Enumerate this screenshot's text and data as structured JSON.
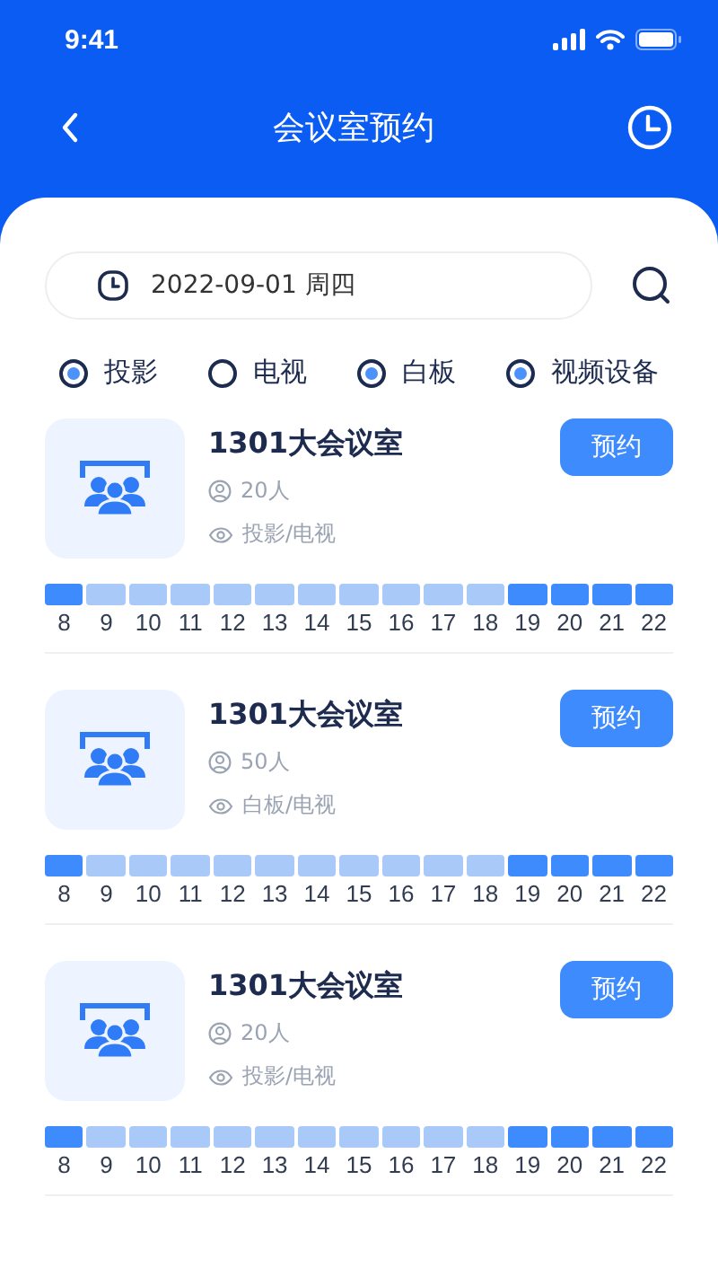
{
  "status_bar": {
    "time": "9:41"
  },
  "nav": {
    "title": "会议室预约"
  },
  "search": {
    "date": "2022-09-01 周四"
  },
  "filters": [
    {
      "label": "投影",
      "selected": true
    },
    {
      "label": "电视",
      "selected": false
    },
    {
      "label": "白板",
      "selected": true
    },
    {
      "label": "视频设备",
      "selected": true
    }
  ],
  "rooms": [
    {
      "name": "1301大会议室",
      "capacity": "20人",
      "equipment": "投影/电视",
      "button": "预约",
      "slots": [
        {
          "hour": "8",
          "booked": true
        },
        {
          "hour": "9",
          "booked": false
        },
        {
          "hour": "10",
          "booked": false
        },
        {
          "hour": "11",
          "booked": false
        },
        {
          "hour": "12",
          "booked": false
        },
        {
          "hour": "13",
          "booked": false
        },
        {
          "hour": "14",
          "booked": false
        },
        {
          "hour": "15",
          "booked": false
        },
        {
          "hour": "16",
          "booked": false
        },
        {
          "hour": "17",
          "booked": false
        },
        {
          "hour": "18",
          "booked": false
        },
        {
          "hour": "19",
          "booked": true
        },
        {
          "hour": "20",
          "booked": true
        },
        {
          "hour": "21",
          "booked": true
        },
        {
          "hour": "22",
          "booked": true
        }
      ]
    },
    {
      "name": "1301大会议室",
      "capacity": "50人",
      "equipment": "白板/电视",
      "button": "预约",
      "slots": [
        {
          "hour": "8",
          "booked": true
        },
        {
          "hour": "9",
          "booked": false
        },
        {
          "hour": "10",
          "booked": false
        },
        {
          "hour": "11",
          "booked": false
        },
        {
          "hour": "12",
          "booked": false
        },
        {
          "hour": "13",
          "booked": false
        },
        {
          "hour": "14",
          "booked": false
        },
        {
          "hour": "15",
          "booked": false
        },
        {
          "hour": "16",
          "booked": false
        },
        {
          "hour": "17",
          "booked": false
        },
        {
          "hour": "18",
          "booked": false
        },
        {
          "hour": "19",
          "booked": true
        },
        {
          "hour": "20",
          "booked": true
        },
        {
          "hour": "21",
          "booked": true
        },
        {
          "hour": "22",
          "booked": true
        }
      ]
    },
    {
      "name": "1301大会议室",
      "capacity": "20人",
      "equipment": "投影/电视",
      "button": "预约",
      "slots": [
        {
          "hour": "8",
          "booked": true
        },
        {
          "hour": "9",
          "booked": false
        },
        {
          "hour": "10",
          "booked": false
        },
        {
          "hour": "11",
          "booked": false
        },
        {
          "hour": "12",
          "booked": false
        },
        {
          "hour": "13",
          "booked": false
        },
        {
          "hour": "14",
          "booked": false
        },
        {
          "hour": "15",
          "booked": false
        },
        {
          "hour": "16",
          "booked": false
        },
        {
          "hour": "17",
          "booked": false
        },
        {
          "hour": "18",
          "booked": false
        },
        {
          "hour": "19",
          "booked": true
        },
        {
          "hour": "20",
          "booked": true
        },
        {
          "hour": "21",
          "booked": true
        },
        {
          "hour": "22",
          "booked": true
        }
      ]
    }
  ]
}
